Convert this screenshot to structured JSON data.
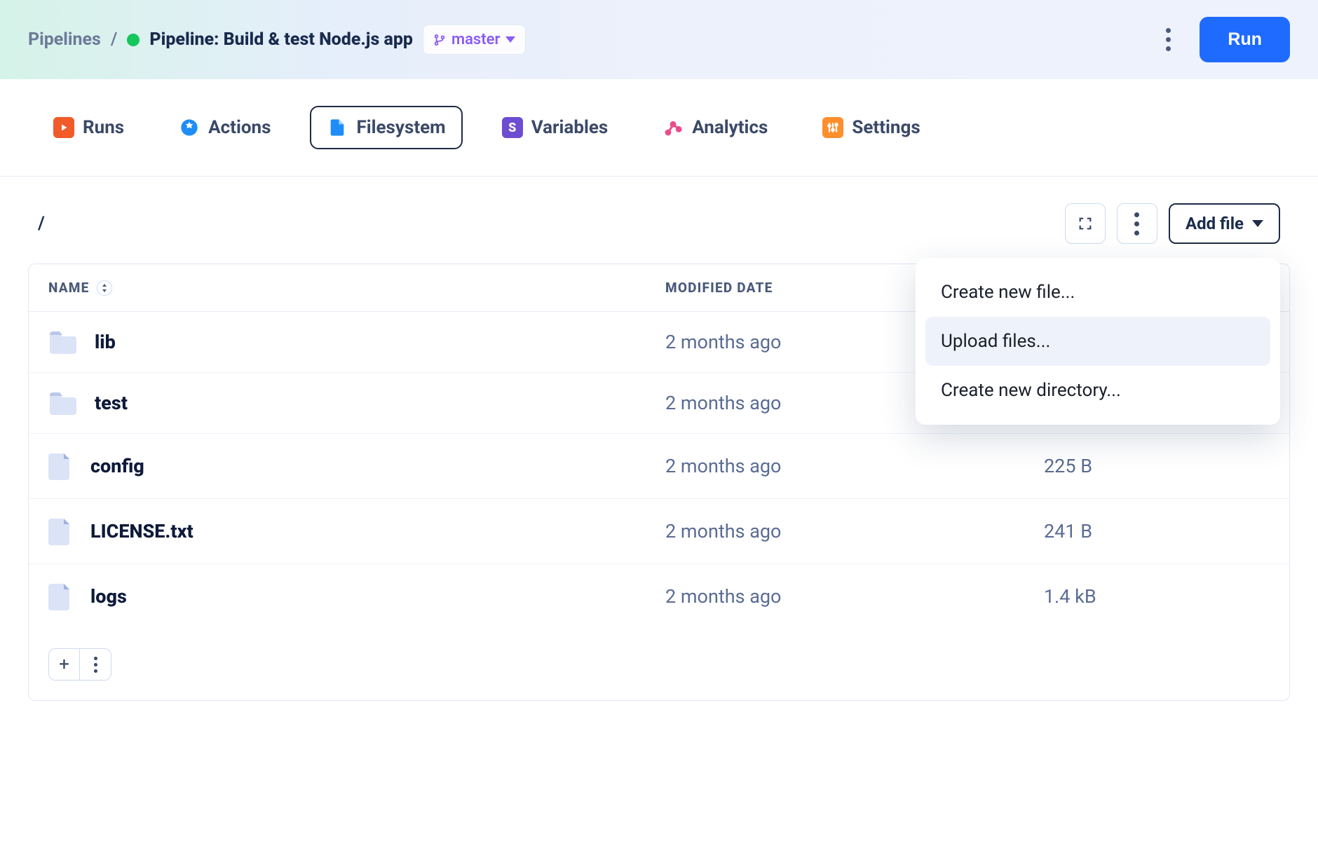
{
  "breadcrumb": {
    "root": "Pipelines",
    "sep": "/"
  },
  "pipeline": {
    "title": "Pipeline: Build & test Node.js app"
  },
  "branch": {
    "label": "master"
  },
  "header": {
    "run_label": "Run"
  },
  "tabs": {
    "runs": "Runs",
    "actions": "Actions",
    "filesystem": "Filesystem",
    "variables": "Variables",
    "analytics": "Analytics",
    "settings": "Settings"
  },
  "path": "/",
  "addfile": {
    "label": "Add file"
  },
  "dropdown": {
    "items": [
      {
        "label": "Create new file..."
      },
      {
        "label": "Upload files..."
      },
      {
        "label": "Create new directory..."
      }
    ]
  },
  "table": {
    "headers": {
      "name": "NAME",
      "modified": "MODIFIED DATE",
      "size": ""
    },
    "rows": [
      {
        "type": "folder",
        "name": "lib",
        "modified": "2 months ago",
        "size": ""
      },
      {
        "type": "folder",
        "name": "test",
        "modified": "2 months ago",
        "size": ""
      },
      {
        "type": "file",
        "name": "config",
        "modified": "2 months ago",
        "size": "225 B"
      },
      {
        "type": "file",
        "name": "LICENSE.txt",
        "modified": "2 months ago",
        "size": "241 B"
      },
      {
        "type": "file",
        "name": "logs",
        "modified": "2 months ago",
        "size": "1.4 kB"
      }
    ]
  }
}
